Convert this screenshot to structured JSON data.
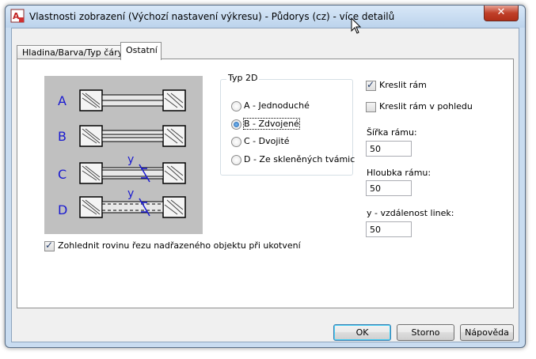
{
  "window": {
    "title": "Vlastnosti zobrazení (Výchozí nastavení výkresu) - Půdorys (cz) - více detailů",
    "close_label": "✕",
    "app_icon": "autocad-icon"
  },
  "tabs": [
    {
      "label": "Hladina/Barva/Typ čáry",
      "active": false
    },
    {
      "label": "Ostatní",
      "active": true
    }
  ],
  "preview": {
    "row_labels": [
      "A",
      "B",
      "C",
      "D"
    ],
    "dimension_label": "y",
    "background_color": "#c0c0c0",
    "label_color": "#1a1ad0"
  },
  "type2d": {
    "label": "Typ 2D",
    "options": [
      {
        "label": "A - Jednoduché",
        "selected": false
      },
      {
        "label": "B - Zdvojené",
        "selected": true
      },
      {
        "label": "C - Dvojité",
        "selected": false
      },
      {
        "label": "D - Ze skleněných tvámic",
        "selected": false
      }
    ]
  },
  "options": {
    "draw_frame": {
      "label": "Kreslit rám",
      "checked": true
    },
    "draw_frame_view": {
      "label": "Kreslit rám v pohledu",
      "checked": false
    },
    "consider_cut_plane": {
      "label": "Zohlednit rovinu řezu nadřazeného objektu při ukotvení",
      "checked": true
    }
  },
  "fields": {
    "frame_width": {
      "label": "Šířka rámu:",
      "value": "50"
    },
    "frame_depth": {
      "label": "Hloubka rámu:",
      "value": "50"
    },
    "line_distance": {
      "label": "y - vzdálenost linek:",
      "value": "50"
    }
  },
  "buttons": {
    "ok": "OK",
    "cancel": "Storno",
    "help": "Nápověda"
  }
}
